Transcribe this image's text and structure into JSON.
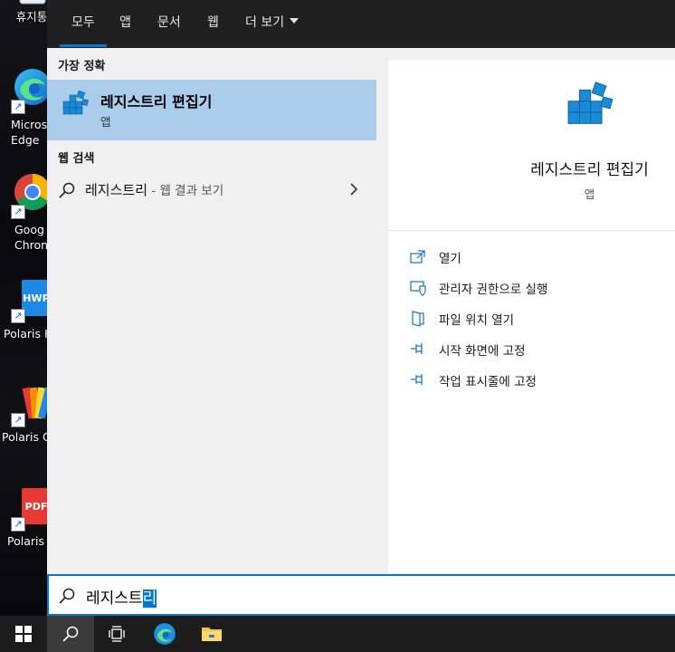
{
  "desktop": {
    "icons": [
      {
        "label": "휴지통",
        "icon": "recycle-bin-icon"
      },
      {
        "label": "Micros\nEdge",
        "icon": "edge-icon"
      },
      {
        "label": "Goog\nChron",
        "icon": "chrome-icon"
      },
      {
        "label": "Polaris H",
        "icon": "polaris-hwp-icon",
        "text": "HWP"
      },
      {
        "label": "Polaris O",
        "icon": "polaris-office-icon"
      },
      {
        "label": "Polaris",
        "icon": "polaris-pdf-icon",
        "text": "PDF"
      }
    ]
  },
  "tabs": [
    {
      "label": "모두"
    },
    {
      "label": "앱"
    },
    {
      "label": "문서"
    },
    {
      "label": "웹"
    },
    {
      "label": "더 보기"
    }
  ],
  "results": {
    "best_header": "가장 정확",
    "best": {
      "title": "레지스트리 편집기",
      "subtitle": "앱",
      "icon": "registry-editor-icon"
    },
    "web_header": "웹 검색",
    "web": {
      "query": "레지스트리",
      "suffix": " - 웹 결과 보기"
    }
  },
  "preview": {
    "title": "레지스트리 편집기",
    "type": "앱",
    "actions": [
      {
        "label": "열기",
        "icon": "open-icon"
      },
      {
        "label": "관리자 권한으로 실행",
        "icon": "shield-admin-icon"
      },
      {
        "label": "파일 위치 열기",
        "icon": "file-location-icon"
      },
      {
        "label": "시작 화면에 고정",
        "icon": "pin-icon"
      },
      {
        "label": "작업 표시줄에 고정",
        "icon": "pin-icon"
      }
    ]
  },
  "search": {
    "typed": "레지스트",
    "selected": "리"
  },
  "taskbar": {
    "items": [
      "start-button",
      "search-button",
      "task-view-button",
      "edge-taskbar-button",
      "file-explorer-button"
    ]
  },
  "colors": {
    "accent": "#0078d7",
    "best_bg": "#aacdeb"
  }
}
